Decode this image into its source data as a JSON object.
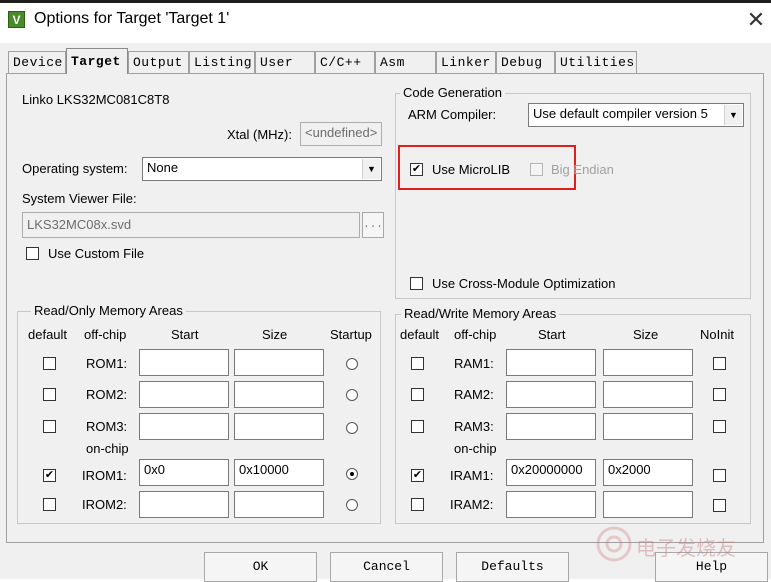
{
  "window": {
    "title": "Options for Target 'Target 1'",
    "close_glyph": "✕",
    "icon_letter": "V"
  },
  "tabs": [
    {
      "label": "Device"
    },
    {
      "label": "Target"
    },
    {
      "label": "Output"
    },
    {
      "label": "Listing"
    },
    {
      "label": "User"
    },
    {
      "label": "C/C++"
    },
    {
      "label": "Asm"
    },
    {
      "label": "Linker"
    },
    {
      "label": "Debug"
    },
    {
      "label": "Utilities"
    }
  ],
  "target": {
    "device_name": "Linko LKS32MC081C8T8",
    "xtal_label": "Xtal (MHz):",
    "xtal_value": "<undefined>",
    "os_label": "Operating system:",
    "os_value": "None",
    "svd_label": "System Viewer File:",
    "svd_value": "LKS32MC08x.svd",
    "browse_label": "...",
    "custom_file_label": "Use Custom File"
  },
  "codegen": {
    "legend": "Code Generation",
    "compiler_label": "ARM Compiler:",
    "compiler_value": "Use default compiler version 5",
    "microlib_label": "Use MicroLIB",
    "microlib_checked": true,
    "big_endian_label": "Big Endian",
    "cross_module_label": "Use Cross-Module Optimization"
  },
  "ro_memory": {
    "legend": "Read/Only Memory Areas",
    "headers": {
      "default": "default",
      "offchip": "off-chip",
      "start": "Start",
      "size": "Size",
      "startup": "Startup"
    },
    "onchip_label": "on-chip",
    "rows": [
      {
        "name": "ROM1:",
        "start": "",
        "size": "",
        "default": false,
        "startup": false
      },
      {
        "name": "ROM2:",
        "start": "",
        "size": "",
        "default": false,
        "startup": false
      },
      {
        "name": "ROM3:",
        "start": "",
        "size": "",
        "default": false,
        "startup": false
      },
      {
        "name": "IROM1:",
        "start": "0x0",
        "size": "0x10000",
        "default": true,
        "startup": true
      },
      {
        "name": "IROM2:",
        "start": "",
        "size": "",
        "default": false,
        "startup": false
      }
    ]
  },
  "rw_memory": {
    "legend": "Read/Write Memory Areas",
    "headers": {
      "default": "default",
      "offchip": "off-chip",
      "start": "Start",
      "size": "Size",
      "noinit": "NoInit"
    },
    "onchip_label": "on-chip",
    "rows": [
      {
        "name": "RAM1:",
        "start": "",
        "size": "",
        "default": false
      },
      {
        "name": "RAM2:",
        "start": "",
        "size": "",
        "default": false
      },
      {
        "name": "RAM3:",
        "start": "",
        "size": "",
        "default": false
      },
      {
        "name": "IRAM1:",
        "start": "0x20000000",
        "size": "0x2000",
        "default": true
      },
      {
        "name": "IRAM2:",
        "start": "",
        "size": "",
        "default": false
      }
    ]
  },
  "buttons": {
    "ok": "OK",
    "cancel": "Cancel",
    "defaults": "Defaults",
    "help": "Help"
  },
  "watermark": "电子发烧友",
  "colors": {
    "highlight_box": "#e02020",
    "accent": "#000000"
  }
}
